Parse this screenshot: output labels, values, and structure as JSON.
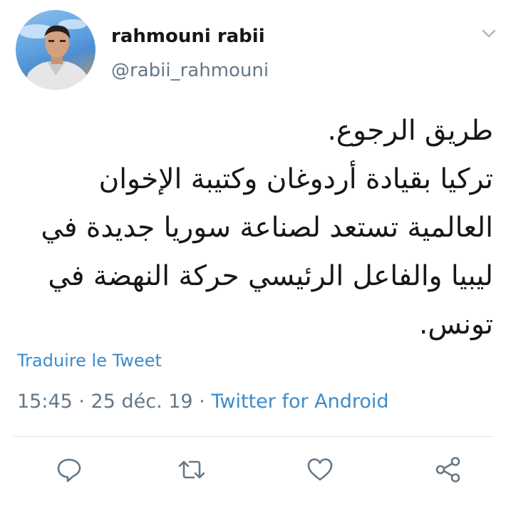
{
  "user": {
    "display_name": "rahmouni rabii",
    "handle": "@rabii_rahmouni",
    "avatar_icon": "user-avatar-photo"
  },
  "tweet": {
    "lines": [
      "طريق الرجوع.",
      "تركيا بقيادة أردوغان وكتيبة الإخوان",
      "العالمية تستعد لصناعة سوريا جديدة في",
      "ليبيا والفاعل الرئيسي حركة النهضة في",
      "تونس."
    ],
    "translate_label": "Traduire le Tweet",
    "timestamp": "15:45 · 25 déc. 19 · ",
    "source": "Twitter for Android"
  },
  "actions": [
    {
      "name": "reply",
      "icon": "reply-icon"
    },
    {
      "name": "retweet",
      "icon": "retweet-icon"
    },
    {
      "name": "like",
      "icon": "heart-icon"
    },
    {
      "name": "share",
      "icon": "share-icon"
    }
  ],
  "colors": {
    "link": "#3b8ccc",
    "secondary_text": "#657786",
    "primary_text": "#14171a",
    "icon": "#657786",
    "divider": "#e1e8ed"
  }
}
